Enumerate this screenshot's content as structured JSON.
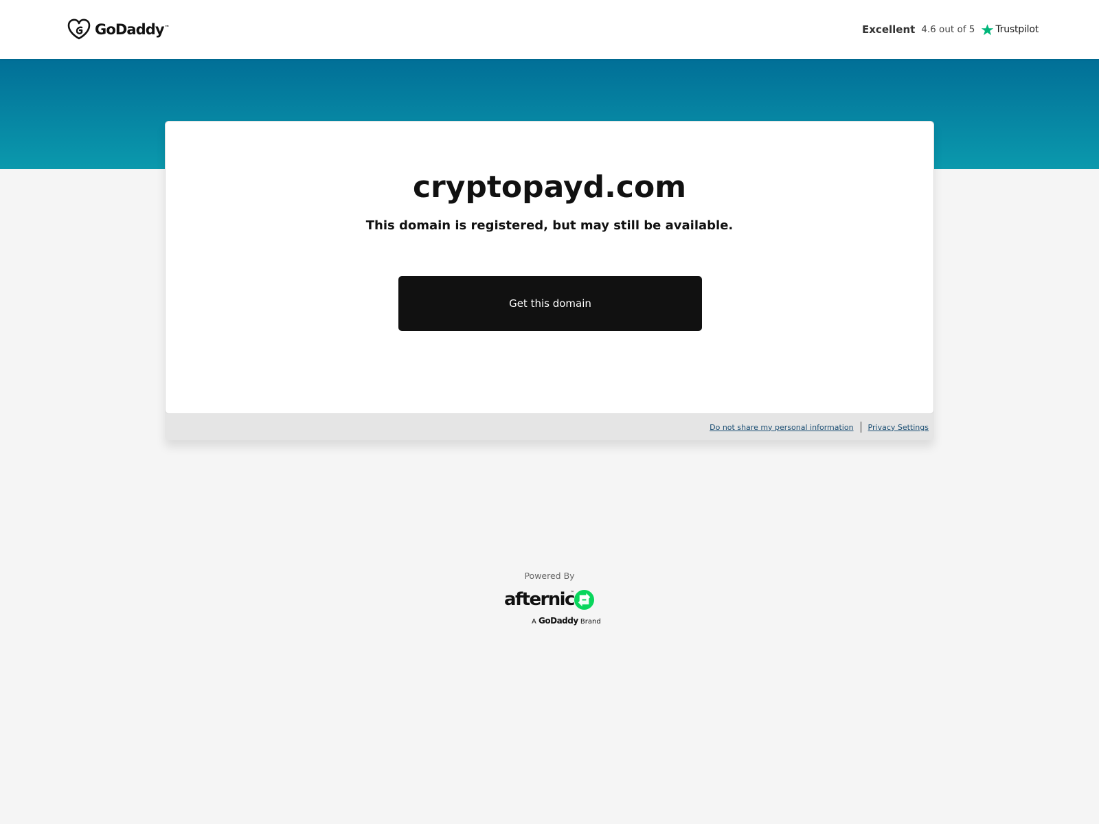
{
  "header": {
    "logo_text": "GoDaddy",
    "logo_tm": "™",
    "trust": {
      "rating_word": "Excellent",
      "score_text": "4.6 out of 5",
      "brand": "Trustpilot",
      "star_color": "#00b67a"
    }
  },
  "card": {
    "domain": "cryptopayd.com",
    "subtitle": "This domain is registered, but may still be available.",
    "cta_label": "Get this domain",
    "footer": {
      "do_not_share": "Do not share my personal information",
      "privacy": "Privacy Settings"
    }
  },
  "powered": {
    "label": "Powered By",
    "brand_word": "afternic",
    "brand_tm": "™",
    "brand_line_prefix": "A",
    "brand_line_parent": "GoDaddy",
    "brand_line_suffix": "Brand",
    "mark_color": "#09d65c"
  },
  "colors": {
    "band_top": "#016f97",
    "band_bottom": "#0b99ad",
    "cta_bg": "#111111",
    "link": "#1b4e73"
  }
}
